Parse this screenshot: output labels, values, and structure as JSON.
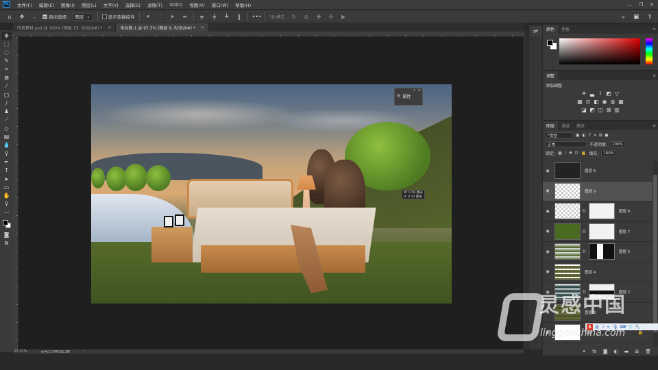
{
  "app": {
    "logo": "Ps"
  },
  "menu": [
    "文件(F)",
    "编辑(E)",
    "图像(I)",
    "图层(L)",
    "文字(Y)",
    "选择(S)",
    "滤镜(T)",
    "3D(D)",
    "视图(V)",
    "窗口(W)",
    "帮助(H)"
  ],
  "window_controls": {
    "minimize": "—",
    "restore": "❐",
    "close": "✕"
  },
  "options_bar": {
    "auto_select_label": "自动选择:",
    "auto_select_checked": true,
    "auto_select_target": "图层",
    "show_transform_label": "显示变换控件",
    "show_transform_checked": false,
    "mode_3d_label": "3D 模式:",
    "more_label": "•••"
  },
  "tabs": [
    {
      "label": "所用素材.psd @ 100% (图层 15, RGB/8#) *",
      "active": false
    },
    {
      "label": "未标题-1 @ 97.3% (图层 9, RGB/8#) *",
      "active": true
    }
  ],
  "tools": [
    "move",
    "marquee",
    "lasso",
    "quick-select",
    "crop",
    "frame",
    "eyedropper",
    "healing",
    "brush",
    "stamp",
    "history-brush",
    "eraser",
    "gradient",
    "blur",
    "dodge",
    "pen",
    "type",
    "path-select",
    "rectangle",
    "hand",
    "zoom",
    "more"
  ],
  "floating_properties": {
    "label": "属性"
  },
  "measure_tooltip": {
    "w": "W: 0.56 厘米",
    "h": "H: 0.12 厘米"
  },
  "status": {
    "zoom": "97.27%",
    "doc": "文档:2.04M/33.2M"
  },
  "color_panel": {
    "tabs": [
      "颜色",
      "色板"
    ],
    "active_tab": "颜色",
    "foreground": "#000000",
    "background": "#ffffff",
    "hue": "#e00000"
  },
  "adjust_panel": {
    "title": "调整",
    "subtitle": "添加调整"
  },
  "layers_panel": {
    "tabs": [
      "图层",
      "通道",
      "路径"
    ],
    "active_tab": "图层",
    "filter_label": "类型",
    "blend_mode": "正常",
    "opacity_label": "不透明度:",
    "opacity_value": "100%",
    "lock_label": "锁定:",
    "fill_label": "填充:",
    "fill_value": "100%",
    "layers": [
      {
        "name": "图层 6",
        "has_mask": false,
        "selected": false
      },
      {
        "name": "图层 9",
        "has_mask": false,
        "selected": true
      },
      {
        "name": "图层 8",
        "has_mask": true,
        "selected": false
      },
      {
        "name": "图层 7",
        "has_mask": true,
        "selected": false
      },
      {
        "name": "图层 5",
        "has_mask": true,
        "selected": false
      },
      {
        "name": "图层 4",
        "has_mask": false,
        "selected": false
      },
      {
        "name": "图层 2",
        "has_mask": true,
        "selected": false
      },
      {
        "name": "图层 3",
        "has_mask": false,
        "selected": false
      },
      {
        "name": "背景",
        "has_mask": false,
        "selected": false
      }
    ]
  },
  "watermark": {
    "cn": "灵感中国",
    "en": "lingganchina.com"
  },
  "ime": {
    "logo": "S",
    "label": "英"
  }
}
